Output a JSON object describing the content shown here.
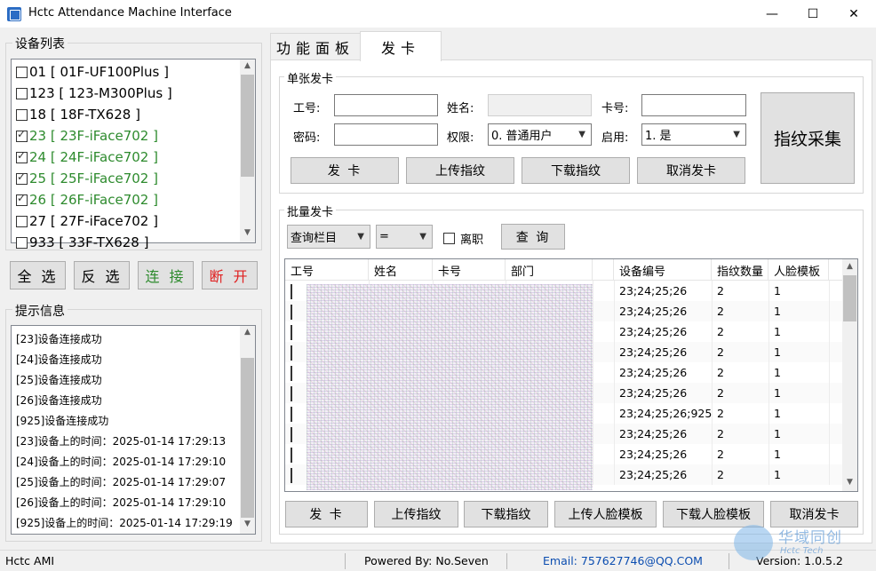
{
  "window": {
    "title": "Hctc Attendance Machine Interface",
    "minimize": "—",
    "maximize": "☐",
    "close": "✕"
  },
  "device_group": {
    "title": "设备列表",
    "devices": [
      {
        "label": "01 [ 01F-UF100Plus ]",
        "checked": false
      },
      {
        "label": "123 [ 123-M300Plus ]",
        "checked": false
      },
      {
        "label": "18 [ 18F-TX628 ]",
        "checked": false
      },
      {
        "label": "23 [ 23F-iFace702 ]",
        "checked": true
      },
      {
        "label": "24 [ 24F-iFace702 ]",
        "checked": true
      },
      {
        "label": "25 [ 25F-iFace702 ]",
        "checked": true
      },
      {
        "label": "26 [ 26F-iFace702 ]",
        "checked": true
      },
      {
        "label": "27 [ 27F-iFace702 ]",
        "checked": false
      },
      {
        "label": "933 [ 33F-TX628 ]",
        "checked": false
      }
    ],
    "buttons": {
      "select_all": "全 选",
      "invert": "反 选",
      "connect": "连 接",
      "disconnect": "断 开"
    }
  },
  "log_group": {
    "title": "提示信息",
    "lines": [
      "[23]设备连接成功",
      "[24]设备连接成功",
      "[25]设备连接成功",
      "[26]设备连接成功",
      "[925]设备连接成功",
      "[23]设备上的时间：2025-01-14 17:29:13",
      "[24]设备上的时间：2025-01-14 17:29:10",
      "[25]设备上的时间：2025-01-14 17:29:07",
      "[26]设备上的时间：2025-01-14 17:29:10",
      "[925]设备上的时间：2025-01-14 17:29:19"
    ]
  },
  "tabs": {
    "function_panel": "功能面板",
    "issue_card": "发卡"
  },
  "single_card": {
    "title": "单张发卡",
    "employee_id_label": "工号:",
    "employee_id_value": "",
    "name_label": "姓名:",
    "name_value": "",
    "card_no_label": "卡号:",
    "card_no_value": "",
    "password_label": "密码:",
    "password_value": "",
    "permission_label": "权限:",
    "permission_value": "0. 普通用户",
    "enable_label": "启用:",
    "enable_value": "1. 是",
    "buttons": {
      "issue": "发  卡",
      "upload_fp": "上传指纹",
      "download_fp": "下载指纹",
      "cancel_issue": "取消发卡"
    },
    "fingerprint_capture": "指纹采集"
  },
  "batch_card": {
    "title": "批量发卡",
    "query_field": "查询栏目",
    "operator": "=",
    "resigned_label": "离职",
    "resigned_checked": false,
    "query_button": "查 询",
    "columns": [
      "工号",
      "姓名",
      "卡号",
      "部门",
      "设备编号",
      "指纹数量",
      "人脸模板"
    ],
    "rows": [
      {
        "device_no": "23;24;25;26",
        "fp_count": "2",
        "face": "1"
      },
      {
        "device_no": "23;24;25;26",
        "fp_count": "2",
        "face": "1"
      },
      {
        "device_no": "23;24;25;26",
        "fp_count": "2",
        "face": "1"
      },
      {
        "device_no": "23;24;25;26",
        "fp_count": "2",
        "face": "1"
      },
      {
        "device_no": "23;24;25;26",
        "fp_count": "2",
        "face": "1"
      },
      {
        "device_no": "23;24;25;26",
        "fp_count": "2",
        "face": "1"
      },
      {
        "device_no": "23;24;25;26;925",
        "fp_count": "2",
        "face": "1"
      },
      {
        "device_no": "23;24;25;26",
        "fp_count": "2",
        "face": "1"
      },
      {
        "device_no": "23;24;25;26",
        "fp_count": "2",
        "face": "1"
      },
      {
        "device_no": "23;24;25;26",
        "fp_count": "2",
        "face": "1"
      }
    ],
    "buttons": {
      "issue": "发  卡",
      "upload_fp": "上传指纹",
      "download_fp": "下载指纹",
      "upload_face": "上传人脸模板",
      "download_face": "下载人脸模板",
      "cancel_issue": "取消发卡"
    }
  },
  "statusbar": {
    "app": "Hctc AMI",
    "powered": "Powered By: No.Seven",
    "email": "Email: 757627746@QQ.COM",
    "version": "Version: 1.0.5.2"
  },
  "watermark": {
    "text": "华域同创",
    "sub": "Hctc Tech"
  },
  "colors": {
    "accent_blue": "#0b4db0",
    "green_text": "#2e8b2e",
    "red_text": "#e02020"
  }
}
